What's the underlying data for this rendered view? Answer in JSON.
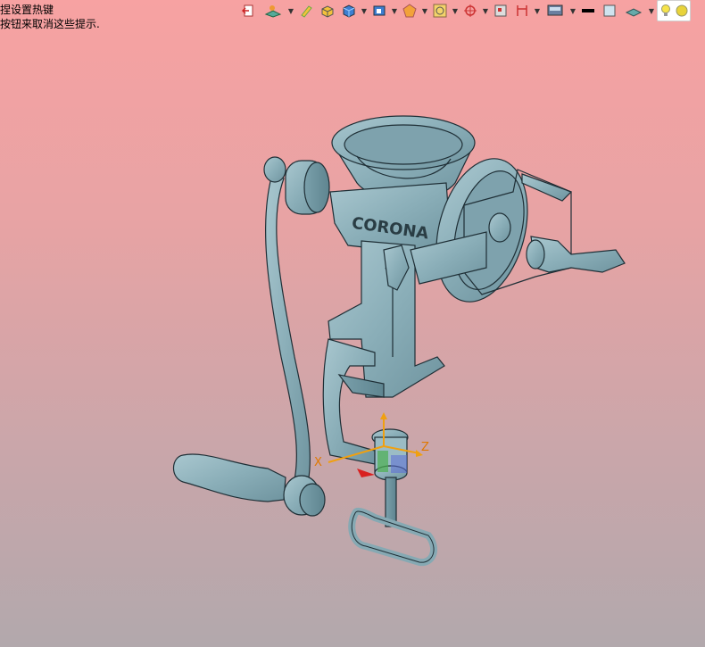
{
  "hint": {
    "line1": "捏设置热键",
    "line2": "按钮来取消这些提示."
  },
  "toolbar": {
    "icons": [
      "exit-icon",
      "layer-tool-icon",
      "pencil-icon",
      "box-color-icon",
      "cube-icon",
      "view-orient-icon",
      "render-style-icon",
      "snap-icon",
      "zoom-fit-icon",
      "target-icon",
      "workplane-icon",
      "section-icon",
      "display-icon",
      "line-color-icon",
      "background-icon",
      "lighting-icon",
      "bulb-icon",
      "sphere-icon"
    ]
  },
  "axes": {
    "x_label": "X",
    "z_label": "Z"
  },
  "model": {
    "brand_text": "CORONA",
    "body_color": "#8db0ba",
    "edge_color": "#1f2f36"
  }
}
